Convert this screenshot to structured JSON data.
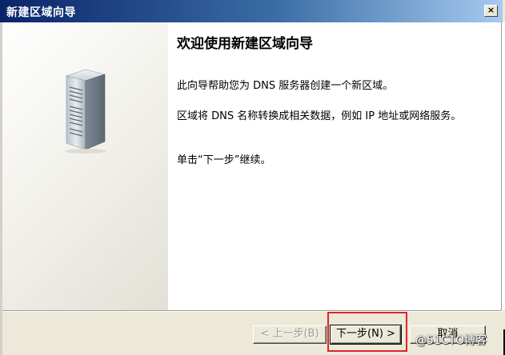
{
  "window": {
    "title": "新建区域向导",
    "close_label": "×"
  },
  "content": {
    "heading": "欢迎使用新建区域向导",
    "paragraphs": [
      "此向导帮助您为 DNS 服务器创建一个新区域。",
      "区域将 DNS 名称转换成相关数据，例如 IP 地址或网络服务。",
      "单击“下一步”继续。"
    ]
  },
  "buttons": {
    "back": "< 上一步(B)",
    "next": "下一步(N) >",
    "cancel": "取消"
  },
  "side_panel": {
    "icon": "server-icon"
  },
  "annotation": {
    "highlight_color": "#e0222a"
  },
  "watermark": "@51CTO博客",
  "colors": {
    "title_bar_start": "#0a246a",
    "title_bar_end": "#a6caf0",
    "dialog_face": "#ece9d8"
  }
}
